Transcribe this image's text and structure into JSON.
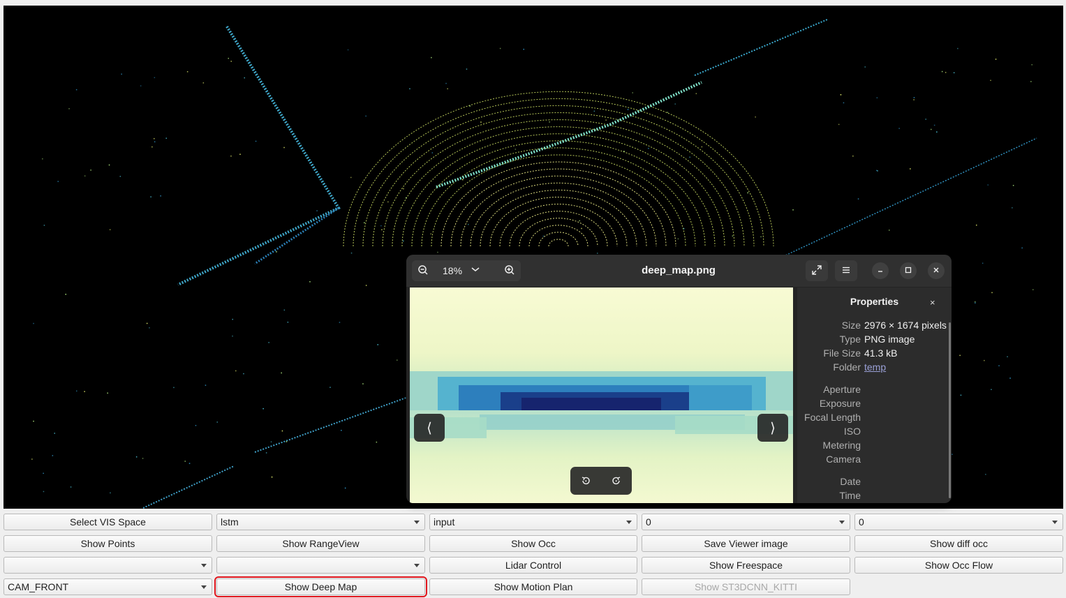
{
  "image_viewer": {
    "title": "deep_map.png",
    "zoom": "18%",
    "icons": {
      "zoom_out": "zoom-out-icon",
      "zoom_in": "zoom-in-icon",
      "fullscreen": "fullscreen-icon",
      "menu": "hamburger-menu-icon",
      "minimize": "minimize-icon",
      "maximize": "maximize-icon",
      "close": "close-icon"
    },
    "nav_prev": "⟨",
    "nav_next": "⟩",
    "properties": {
      "title": "Properties",
      "close": "×",
      "rows": [
        {
          "key": "Size",
          "value": "2976 × 1674 pixels"
        },
        {
          "key": "Type",
          "value": "PNG image"
        },
        {
          "key": "File Size",
          "value": "41.3 kB"
        },
        {
          "key": "Folder",
          "value": "temp"
        },
        {
          "key": "Aperture",
          "value": ""
        },
        {
          "key": "Exposure",
          "value": ""
        },
        {
          "key": "Focal Length",
          "value": ""
        },
        {
          "key": "ISO",
          "value": ""
        },
        {
          "key": "Metering",
          "value": ""
        },
        {
          "key": "Camera",
          "value": ""
        },
        {
          "key": "Date",
          "value": ""
        },
        {
          "key": "Time",
          "value": ""
        }
      ]
    }
  },
  "controls": {
    "row1": [
      "Select VIS Space",
      "lstm",
      "input",
      "0",
      "0"
    ],
    "row2": [
      "Show Points",
      "Show RangeView",
      "Show Occ",
      "Save Viewer image",
      "Show diff occ"
    ],
    "row3": [
      "",
      "",
      "Lidar Control",
      "Show Freespace",
      "Show Occ Flow"
    ],
    "row4": [
      "CAM_FRONT",
      "Show Deep Map",
      "Show Motion Plan",
      "Show ST3DCNN_KITTI"
    ]
  },
  "colors": {
    "highlight": "#e0161d",
    "viewer_bg": "#000000",
    "window_bg": "#242424"
  }
}
